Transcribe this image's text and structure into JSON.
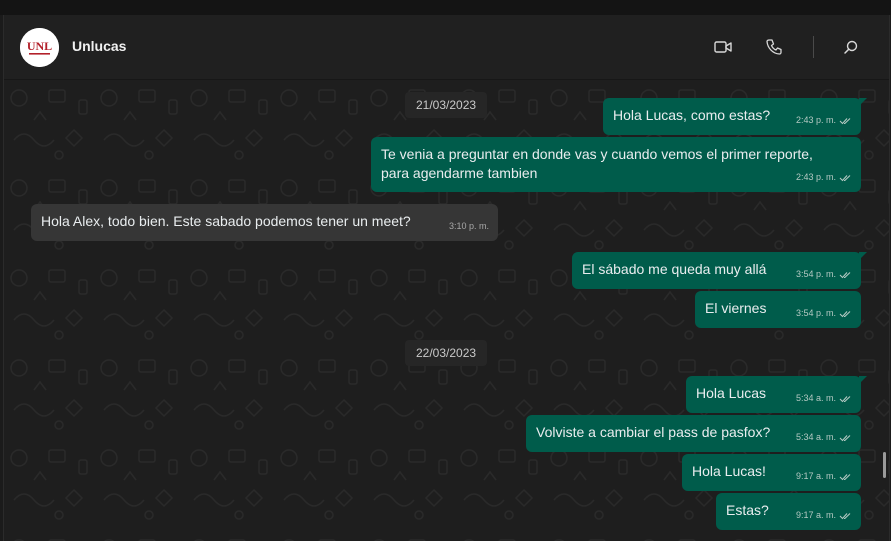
{
  "contact": {
    "name": "Unlucas",
    "avatar_text": "UNL"
  },
  "header": {
    "icons": [
      "video-call-icon",
      "voice-call-icon",
      "search-icon"
    ]
  },
  "dates": [
    "21/03/2023",
    "22/03/2023"
  ],
  "messages": [
    {
      "text": "Hola Lucas, como estas?",
      "time": "2:43 p. m.",
      "direction": "out",
      "status": "read"
    },
    {
      "text": "Te venia a preguntar en donde vas y cuando vemos el primer reporte, para agendarme tambien",
      "time": "2:43 p. m.",
      "direction": "out",
      "status": "read"
    },
    {
      "text": "Hola Alex, todo bien. Este sabado podemos tener un meet?",
      "time": "3:10 p. m.",
      "direction": "in"
    },
    {
      "text": "El sábado me queda muy allá",
      "time": "3:54 p. m.",
      "direction": "out",
      "status": "read"
    },
    {
      "text": "El viernes",
      "time": "3:54 p. m.",
      "direction": "out",
      "status": "read"
    },
    {
      "text": "Hola Lucas",
      "time": "5:34 a. m.",
      "direction": "out",
      "status": "read"
    },
    {
      "text": "Volviste a cambiar el pass de pasfox?",
      "time": "5:34 a. m.",
      "direction": "out",
      "status": "read"
    },
    {
      "text": "Hola Lucas!",
      "time": "9:17 a. m.",
      "direction": "out",
      "status": "read"
    },
    {
      "text": "Estas?",
      "time": "9:17 a. m.",
      "direction": "out",
      "status": "read"
    }
  ],
  "colors": {
    "outgoing_bubble": "#005c4b",
    "incoming_bubble": "#363636",
    "background": "#1e1e1e"
  }
}
